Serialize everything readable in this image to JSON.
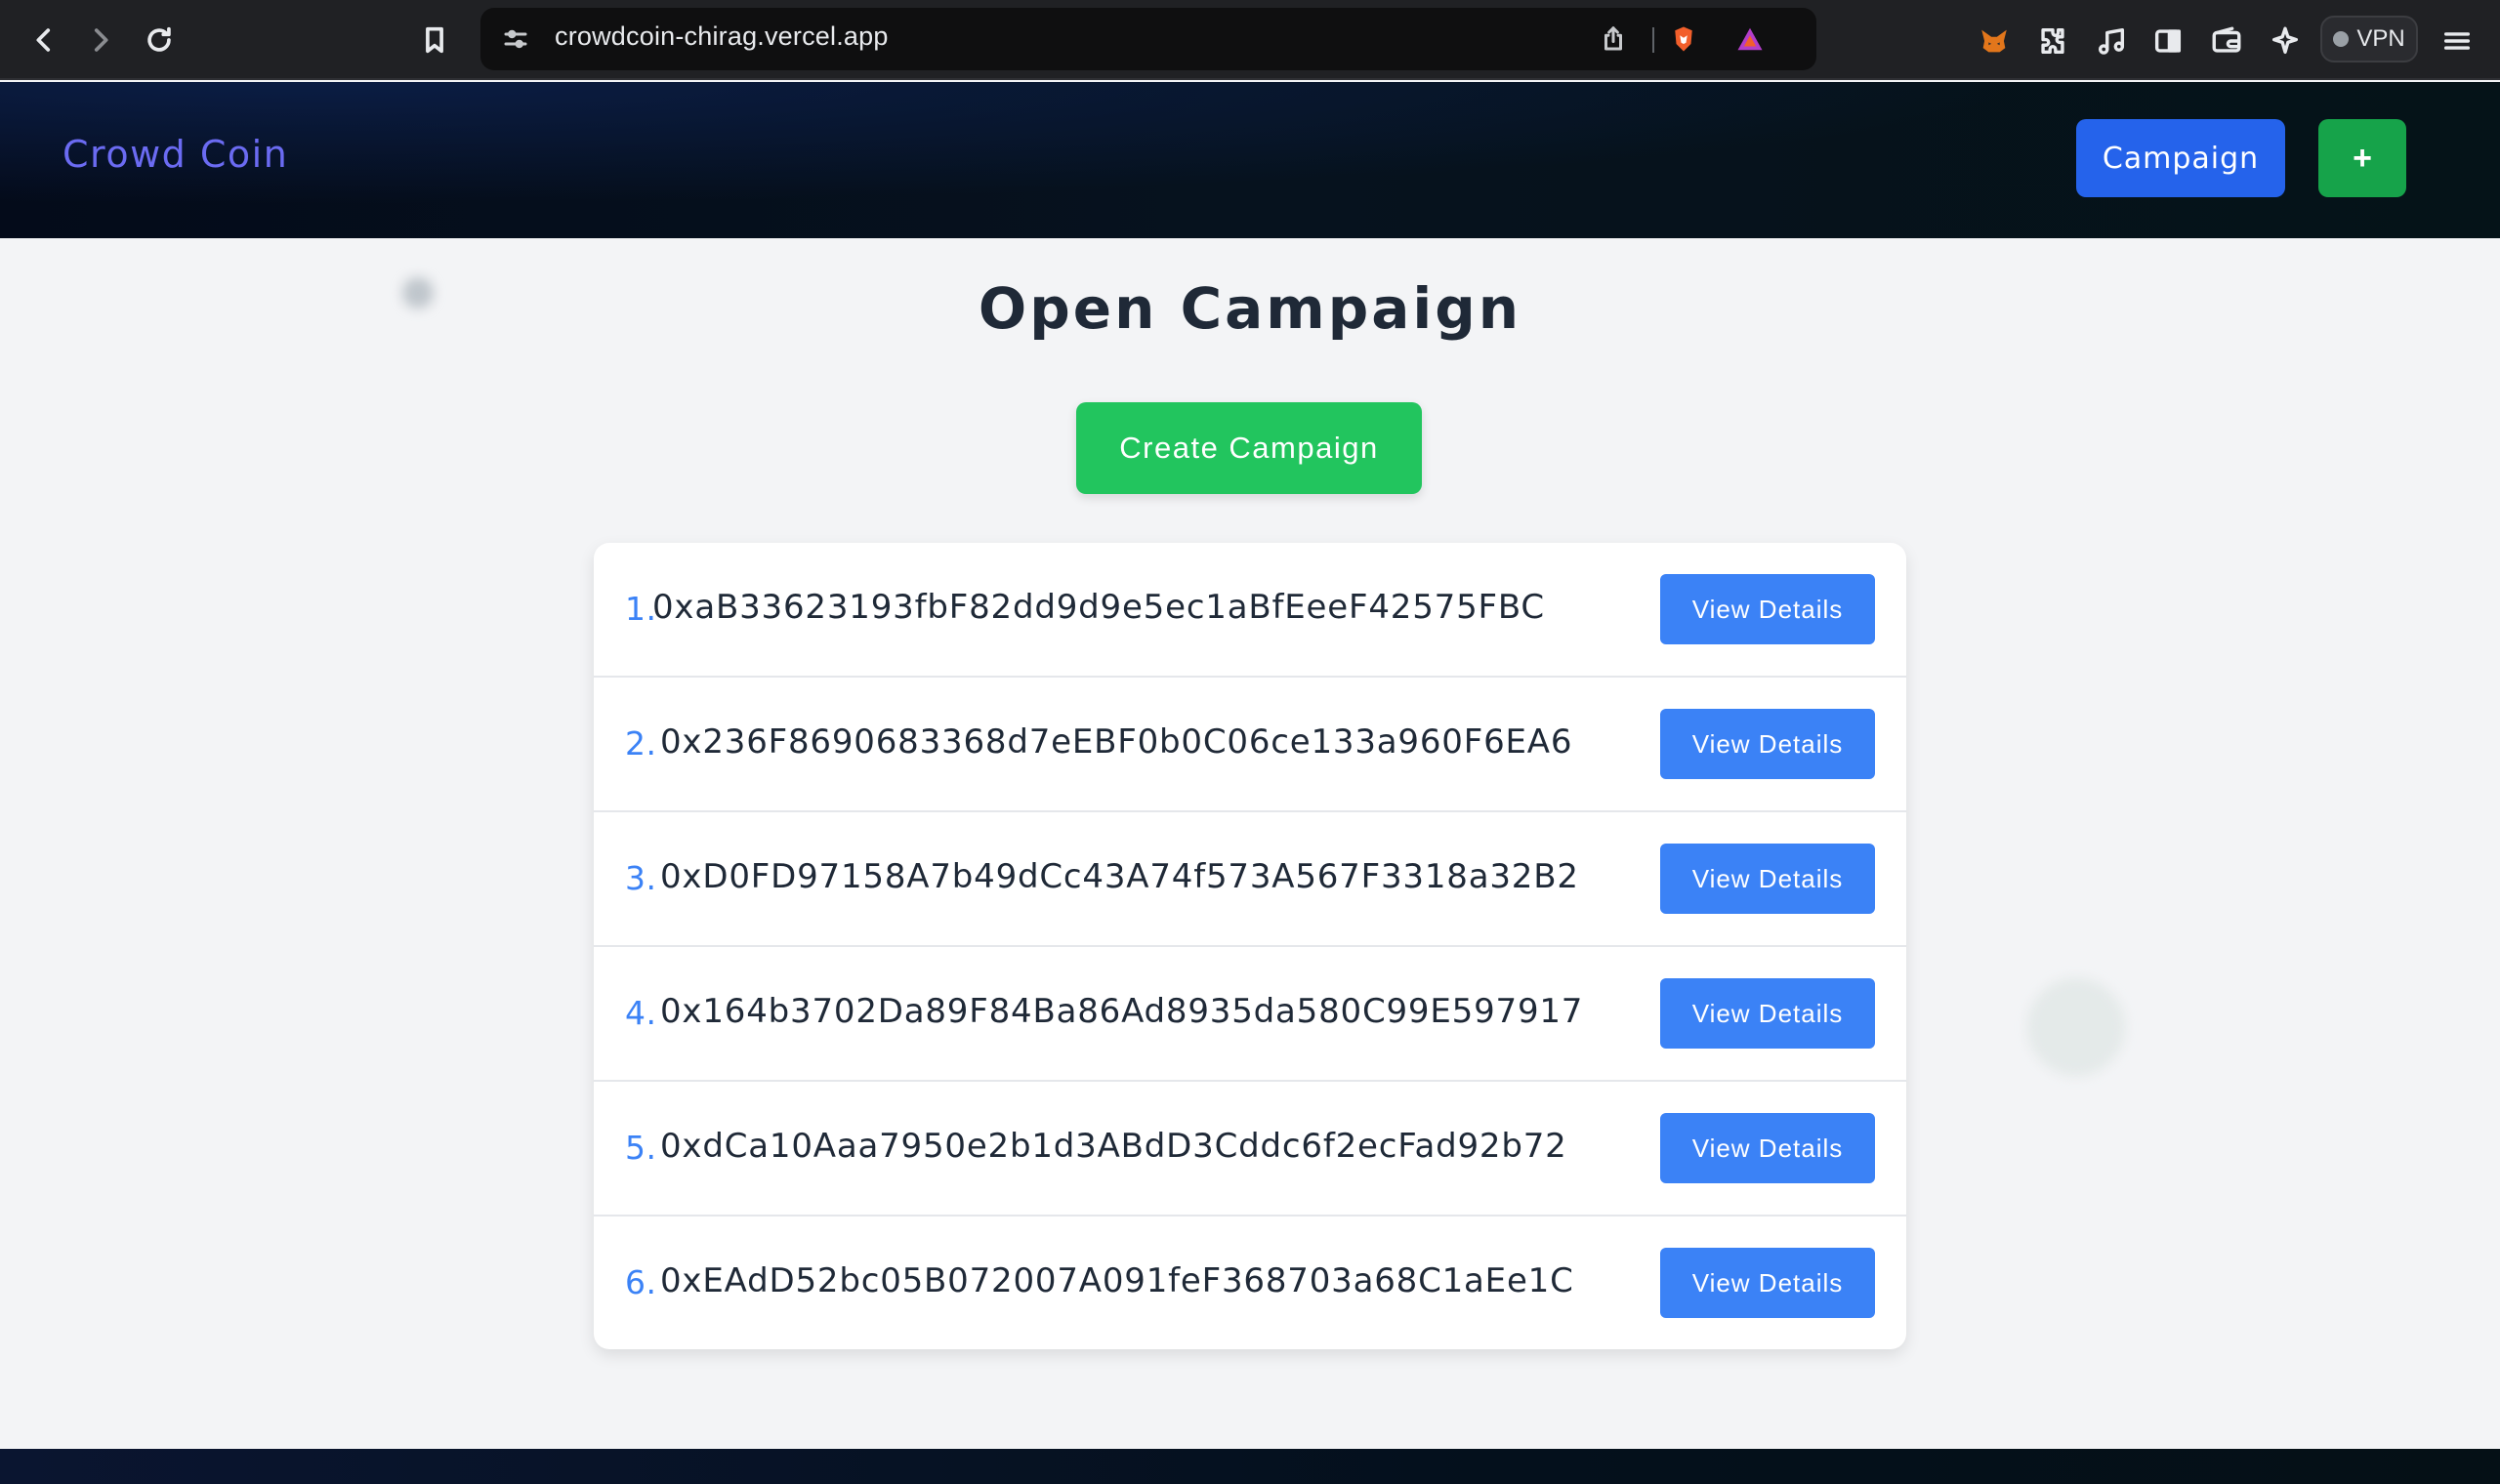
{
  "browser": {
    "url": "crowdcoin-chirag.vercel.app",
    "vpn_label": "VPN"
  },
  "header": {
    "brand": "Crowd Coin",
    "campaign_button": "Campaign",
    "add_button": "+"
  },
  "main": {
    "title": "Open Campaign",
    "create_button": "Create Campaign",
    "campaigns": [
      {
        "num": "1.",
        "address": "0xaB33623193fbF82dd9d9e5ec1aBfEeeF42575FBC",
        "action": "View Details"
      },
      {
        "num": "2.",
        "address": "0x236F8690683368d7eEBF0b0C06ce133a960F6EA6",
        "action": "View Details"
      },
      {
        "num": "3.",
        "address": "0xD0FD97158A7b49dCc43A74f573A567F3318a32B2",
        "action": "View Details"
      },
      {
        "num": "4.",
        "address": "0x164b3702Da89F84Ba86Ad8935da580C99E597917",
        "action": "View Details"
      },
      {
        "num": "5.",
        "address": "0xdCa10Aaa7950e2b1d3ABdD3Cddc6f2ecFad92b72",
        "action": "View Details"
      },
      {
        "num": "6.",
        "address": "0xEAdD52bc05B072007A091feF368703a68C1aEe1C",
        "action": "View Details"
      }
    ]
  },
  "colors": {
    "brand": "#6b6bf2",
    "primary": "#2563eb",
    "success": "#22c55e",
    "row_number": "#3b82f6"
  }
}
